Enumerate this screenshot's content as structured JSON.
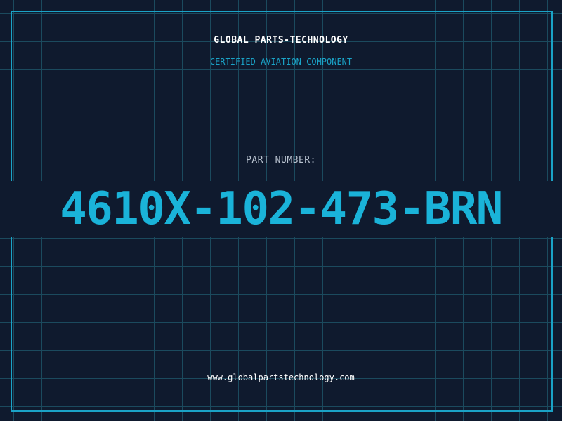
{
  "header": {
    "brand": "GLOBAL PARTS-TECHNOLOGY",
    "subtitle": "CERTIFIED AVIATION COMPONENT"
  },
  "part": {
    "label": "PART NUMBER:",
    "number": "4610X-102-473-BRN"
  },
  "footer": {
    "url": "www.globalpartstechnology.com"
  },
  "colors": {
    "background": "#0f1a2e",
    "grid": "#1b4a5e",
    "accent": "#1aa3c7",
    "part_number": "#1ab3d9",
    "text_light": "#ffffff",
    "text_muted": "#b8c2cf"
  }
}
